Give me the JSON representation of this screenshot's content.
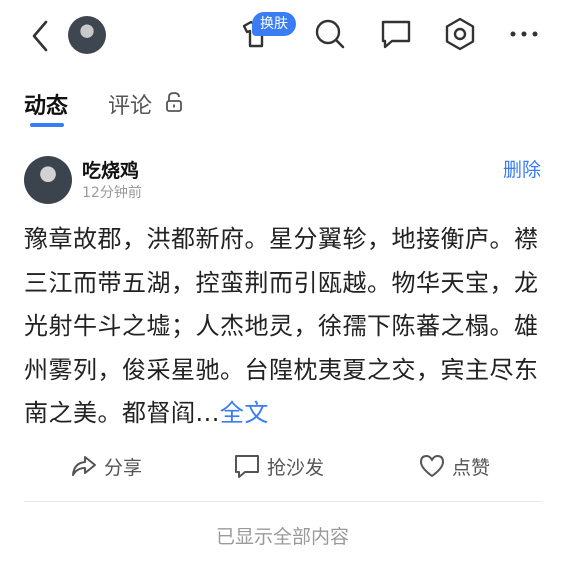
{
  "header": {
    "skin_badge": "换肤",
    "icons": [
      "back-icon",
      "avatar",
      "skin-icon",
      "search-icon",
      "message-icon",
      "settings-icon",
      "more-icon"
    ],
    "accent_color": "#3a7cf3"
  },
  "tabs": [
    {
      "label": "动态",
      "active": true
    },
    {
      "label": "评论",
      "locked": true
    }
  ],
  "post": {
    "author": "吃烧鸡",
    "time": "12分钟前",
    "delete_label": "删除",
    "content": "豫章故郡，洪都新府。星分翼轸，地接衡庐。襟三江而带五湖，控蛮荆而引瓯越。物华天宝，龙光射牛斗之墟；人杰地灵，徐孺下陈蕃之榻。雄州雾列，俊采星驰。台隍枕夷夏之交，宾主尽东南之美。都督阎...",
    "full_text_label": "全文"
  },
  "actions": {
    "share": "分享",
    "comment": "抢沙发",
    "like": "点赞"
  },
  "footer": "已显示全部内容"
}
